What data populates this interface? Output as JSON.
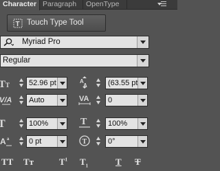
{
  "tabs": {
    "character": "Character",
    "paragraph": "Paragraph",
    "opentype": "OpenType",
    "prefix_letter": "C"
  },
  "touch_type_tool": {
    "label": "Touch Type Tool"
  },
  "font_family": {
    "value": "Myriad Pro"
  },
  "font_style": {
    "value": "Regular"
  },
  "fields": {
    "font_size": "52.96 pt",
    "leading": "(63.55 pt",
    "kerning": "Auto",
    "tracking": "0",
    "vertical_scale": "100%",
    "horizontal_scale": "100%",
    "baseline_shift": "0 pt",
    "rotation": "0°"
  },
  "bottom_buttons": {
    "all_caps": "TT",
    "small_caps": "Tт",
    "superscript": "T",
    "subscript": "T",
    "underline": "T",
    "strikethrough": "T"
  },
  "icons": [
    "menu-icon",
    "touch-type-icon",
    "search-icon",
    "font-size-icon",
    "leading-icon",
    "kerning-icon",
    "tracking-icon",
    "vertical-scale-icon",
    "horizontal-scale-icon",
    "baseline-shift-icon",
    "rotation-icon"
  ]
}
